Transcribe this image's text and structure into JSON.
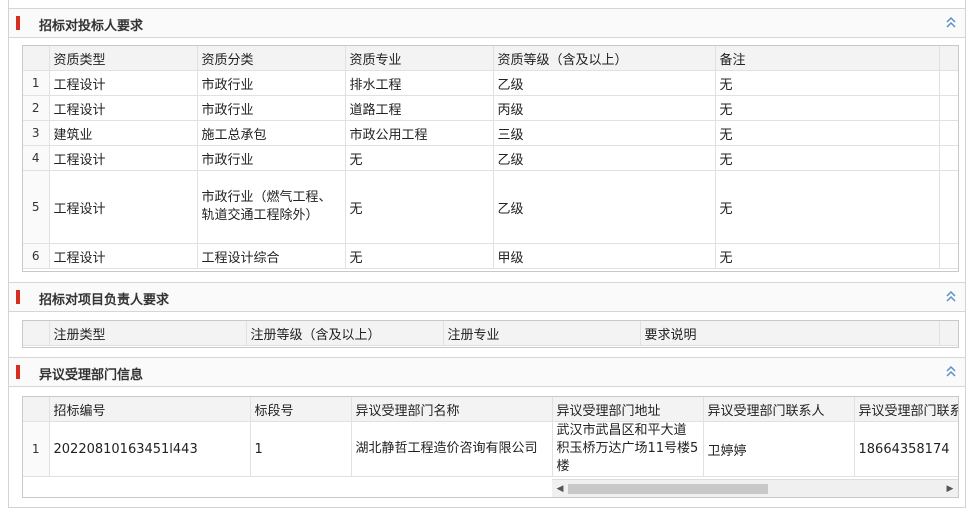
{
  "sections": {
    "bidder": {
      "title": "招标对投标人要求",
      "headers": [
        "资质类型",
        "资质分类",
        "资质专业",
        "资质等级（含及以上）",
        "备注"
      ],
      "rows": [
        {
          "num": "1",
          "type": "工程设计",
          "category": "市政行业",
          "specialty": "排水工程",
          "grade": "乙级",
          "note": "无"
        },
        {
          "num": "2",
          "type": "工程设计",
          "category": "市政行业",
          "specialty": "道路工程",
          "grade": "丙级",
          "note": "无"
        },
        {
          "num": "3",
          "type": "建筑业",
          "category": "施工总承包",
          "specialty": "市政公用工程",
          "grade": "三级",
          "note": "无"
        },
        {
          "num": "4",
          "type": "工程设计",
          "category": "市政行业",
          "specialty": "无",
          "grade": "乙级",
          "note": "无"
        },
        {
          "num": "5",
          "type": "工程设计",
          "category": "市政行业（燃气工程、轨道交通工程除外）",
          "specialty": "无",
          "grade": "乙级",
          "note": "无"
        },
        {
          "num": "6",
          "type": "工程设计",
          "category": "工程设计综合",
          "specialty": "无",
          "grade": "甲级",
          "note": "无"
        }
      ]
    },
    "manager": {
      "title": "招标对项目负责人要求",
      "headers": [
        "注册类型",
        "注册等级（含及以上）",
        "注册专业",
        "要求说明"
      ]
    },
    "objection": {
      "title": "异议受理部门信息",
      "headers": [
        "招标编号",
        "标段号",
        "异议受理部门名称",
        "异议受理部门地址",
        "异议受理部门联系人",
        "异议受理部门联系电话"
      ],
      "rows": [
        {
          "num": "1",
          "code": "20220810163451l443",
          "lot": "1",
          "dept": "湖北静哲工程造价咨询有限公司",
          "address": "武汉市武昌区和平大道积玉桥万达广场11号楼5楼",
          "contact": "卫婷婷",
          "phone": "18664358174"
        }
      ]
    }
  },
  "colors": {
    "accent_bar": "#d52d1f",
    "collapse_icon": "#5b8fc7"
  },
  "icons": {
    "collapse": "double-chevron-up-icon",
    "scroll_left": "arrow-left-icon",
    "scroll_right": "arrow-right-icon"
  }
}
